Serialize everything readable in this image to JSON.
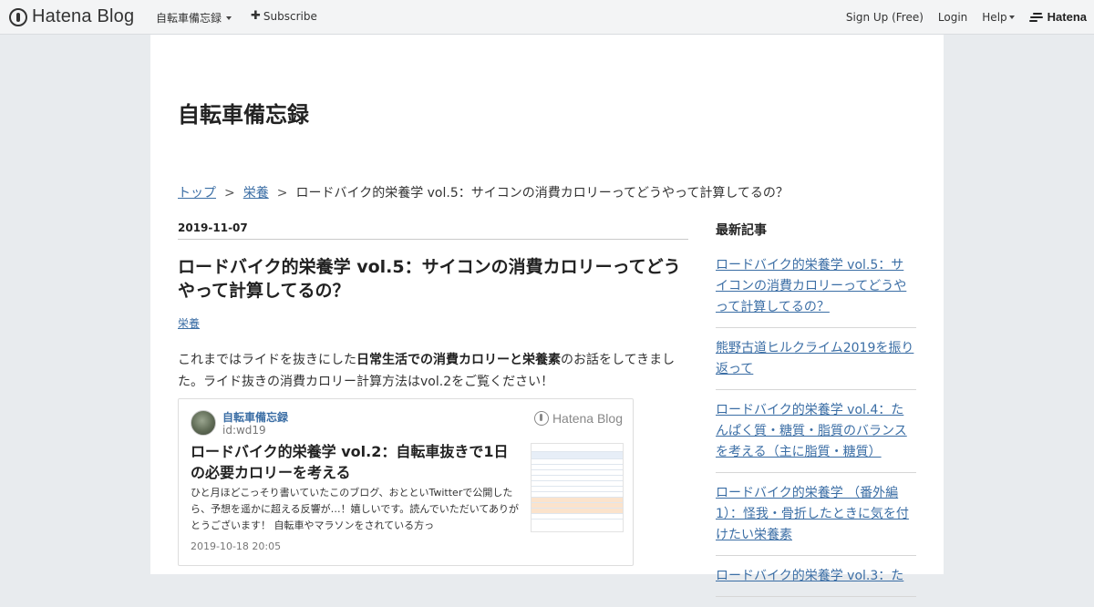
{
  "globalbar": {
    "logo_text": "Hatena Blog",
    "blog_menu_label": "自転車備忘録",
    "subscribe_label": "Subscribe",
    "signup_label": "Sign Up (Free)",
    "login_label": "Login",
    "help_label": "Help",
    "hatena_label": "Hatena",
    "icons": [
      "hatena-blog-logo-icon",
      "chevron-down-icon",
      "plus-icon",
      "hatena-logo-icon"
    ]
  },
  "blog": {
    "title": "自転車備忘録"
  },
  "breadcrumb": {
    "items": [
      "トップ",
      "栄養",
      "ロードバイク的栄養学 vol.5：サイコンの消費カロリーってどうやって計算してるの？"
    ],
    "separator": ">"
  },
  "entry": {
    "date": "2019-11-07",
    "title": "ロードバイク的栄養学 vol.5：サイコンの消費カロリーってどうやって計算してるの？",
    "category": "栄養",
    "body_prefix": "これまではライドを抜きにした",
    "body_bold": "日常生活での消費カロリーと栄養素",
    "body_suffix": "のお話をしてきました。ライド抜きの消費カロリー計算方法はvol.2をご覧ください！"
  },
  "embed_card": {
    "blog_name": "自転車備忘録",
    "user_id": "id:wd19",
    "brand": "Hatena Blog",
    "title": "ロードバイク的栄養学 vol.2：自転車抜きで1日の必要カロリーを考える",
    "description": "ひと月ほどこっそり書いていたこのブログ、おとといTwitterで公開したら、予想を遥かに超える反響が…！嬉しいです。読んでいただいてありがとうございます！ 自転車やマラソンをされている方っ",
    "date": "2019-10-18 20:05"
  },
  "sidebar": {
    "title": "最新記事",
    "items": [
      "ロードバイク的栄養学 vol.5：サイコンの消費カロリーってどうやって計算してるの？",
      "熊野古道ヒルクライム2019を振り返って",
      "ロードバイク的栄養学 vol.4：たんぱく質・糖質・脂質のバランスを考える（主に脂質・糖質）",
      "ロードバイク的栄養学 （番外編1）：怪我・骨折したときに気を付けたい栄養素",
      "ロードバイク的栄養学 vol.3：た"
    ]
  },
  "colors": {
    "link": "#3b6ea5",
    "page_bg": "#e8ebee",
    "header_bg": "#f3f4f5"
  }
}
